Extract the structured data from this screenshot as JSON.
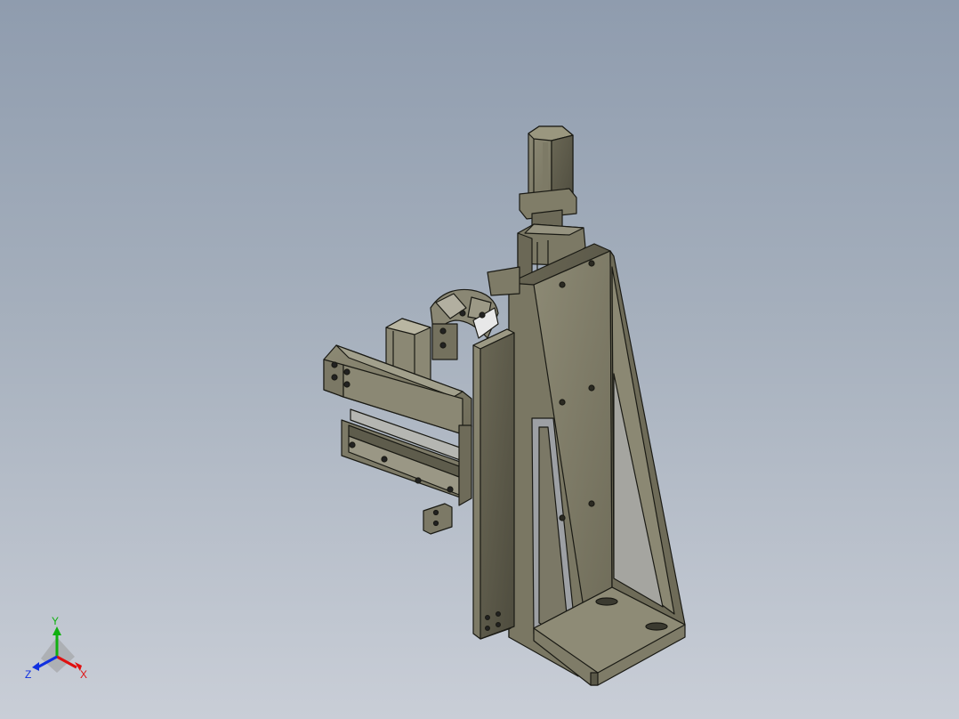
{
  "colors": {
    "background_top": "#8f9cae",
    "background_bottom": "#c9ced7",
    "part_face_light": "#8a8772",
    "part_face_mid": "#76735f",
    "part_face_dark": "#5f5c4b",
    "edge": "#1a1a14",
    "axis_x": "#e01010",
    "axis_y": "#10b010",
    "axis_z": "#1030e0"
  },
  "triad": {
    "x_label": "X",
    "y_label": "Y",
    "z_label": "Z"
  }
}
